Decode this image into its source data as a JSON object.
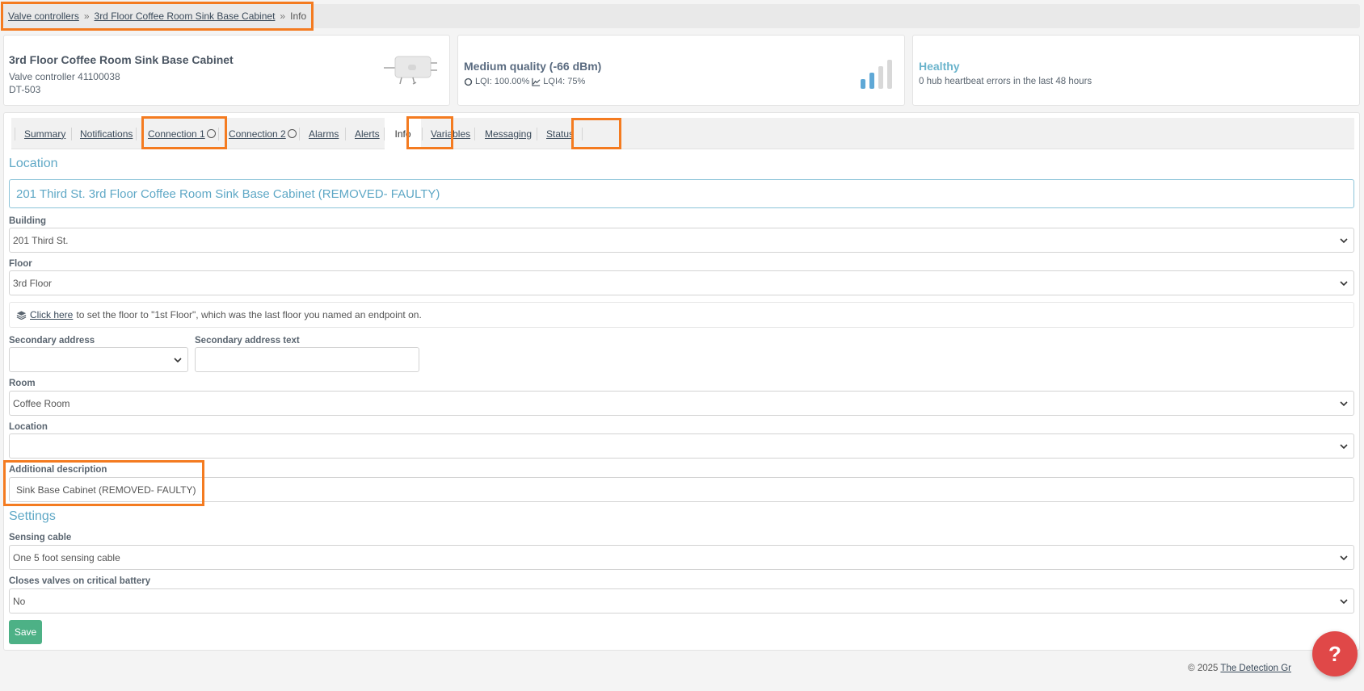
{
  "breadcrumb": {
    "items": [
      "Valve controllers",
      "3rd Floor Coffee Room Sink Base Cabinet"
    ],
    "separator": "»",
    "current": "Info"
  },
  "device": {
    "name": "3rd Floor Coffee Room Sink Base Cabinet",
    "type": "Valve controller 41100038",
    "model": "DT-503"
  },
  "signal": {
    "title": "Medium quality (-66 dBm)",
    "lqi": "LQI: 100.00%",
    "lqi4": "LQI4: 75%",
    "bars_active": 2,
    "bars_total": 4
  },
  "health": {
    "title": "Healthy",
    "detail": "0 hub heartbeat errors in the last 48 hours"
  },
  "tabs": [
    "Summary",
    "Notifications",
    "Connection 1",
    "Connection 2",
    "Alarms",
    "Alerts",
    "Info",
    "Variables",
    "Messaging",
    "Status"
  ],
  "active_tab": "Info",
  "location_section": {
    "heading": "Location",
    "full_location": "201 Third St. 3rd Floor Coffee Room Sink Base Cabinet (REMOVED- FAULTY)",
    "building_label": "Building",
    "building_value": "201 Third St.",
    "floor_label": "Floor",
    "floor_value": "3rd Floor",
    "hint_link": "Click here",
    "hint_text": "to set the floor to \"1st Floor\", which was the last floor you named an endpoint on.",
    "secondary_address_label": "Secondary address",
    "secondary_address_value": "",
    "secondary_address_text_label": "Secondary address text",
    "secondary_address_text_value": "",
    "room_label": "Room",
    "room_value": "Coffee Room",
    "location_label": "Location",
    "location_value": "",
    "additional_description_label": "Additional description",
    "additional_description_value": "Sink Base Cabinet (REMOVED- FAULTY)"
  },
  "settings_section": {
    "heading": "Settings",
    "sensing_cable_label": "Sensing cable",
    "sensing_cable_value": "One 5 foot sensing cable",
    "critical_battery_label": "Closes valves on critical battery",
    "critical_battery_value": "No"
  },
  "save_label": "Save",
  "footer": {
    "copyright": "© 2025",
    "company": "The Detection Gr"
  },
  "help_label": "?",
  "colors": {
    "accent": "#5fa8c6",
    "highlight": "#f47b20",
    "save": "#4db186",
    "help": "#e04848"
  }
}
